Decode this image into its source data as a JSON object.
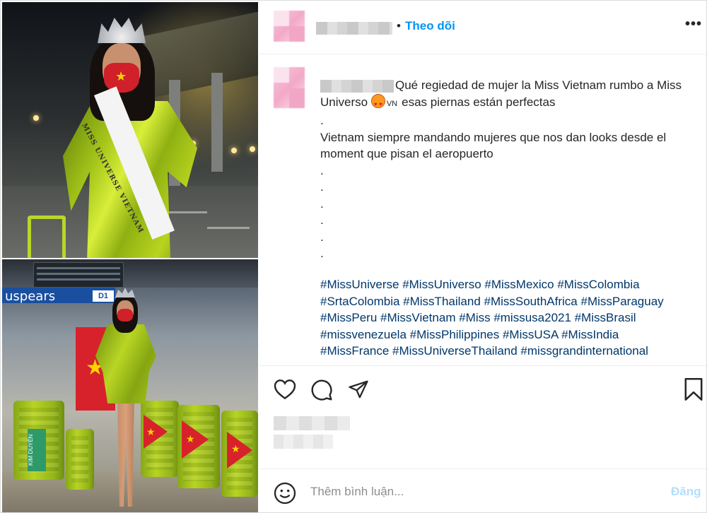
{
  "header": {
    "separator": "•",
    "follow_label": "Theo dõi",
    "more_label": "•••"
  },
  "caption": {
    "lines": [
      "Qué regiedad de mujer la Miss Vietnam rumbo a Miss",
      "esas piernas están perfectas",
      ".",
      "Vietnam siempre mandando mujeres que nos dan looks desde el",
      "moment que pisan el aeropuerto",
      ".",
      ".",
      ".",
      ".",
      ".",
      "."
    ],
    "universo_word": "Universo",
    "flag_code": "VN",
    "emoji": "heart-eyes"
  },
  "hashtags": [
    "#MissUniverse #MissUniverso #MissMexico #MissColombia",
    "#SrtaColombia #MissThailand #MissSouthAfrica #MissParaguay",
    "#MissPeru #MissVietnam #Miss #missusa2021 #MissBrasil",
    "#missvenezuela #MissPhilippines #MissUSA #MissIndia",
    "#MissFrance #MissUniverseThailand #missgrandinternational"
  ],
  "actions": {
    "like_icon": "heart-outline-icon",
    "comment_icon": "speech-bubble-icon",
    "share_icon": "paper-plane-icon",
    "save_icon": "bookmark-icon"
  },
  "comment_bar": {
    "emoji_icon": "smiley-icon",
    "placeholder": "Thêm bình luận...",
    "post_label": "Đăng"
  },
  "photo": {
    "sash_text": "MISS UNIVERSE VIETNAM",
    "airport_sign": "uspears",
    "gate": "D1",
    "luggage_tag": "KIM DUYÊN"
  },
  "colors": {
    "accent": "#0095f6",
    "hashtag": "#00376b",
    "post_disabled": "#b2dffc",
    "dress": "#b9d624",
    "flag_red": "#d7222b"
  }
}
